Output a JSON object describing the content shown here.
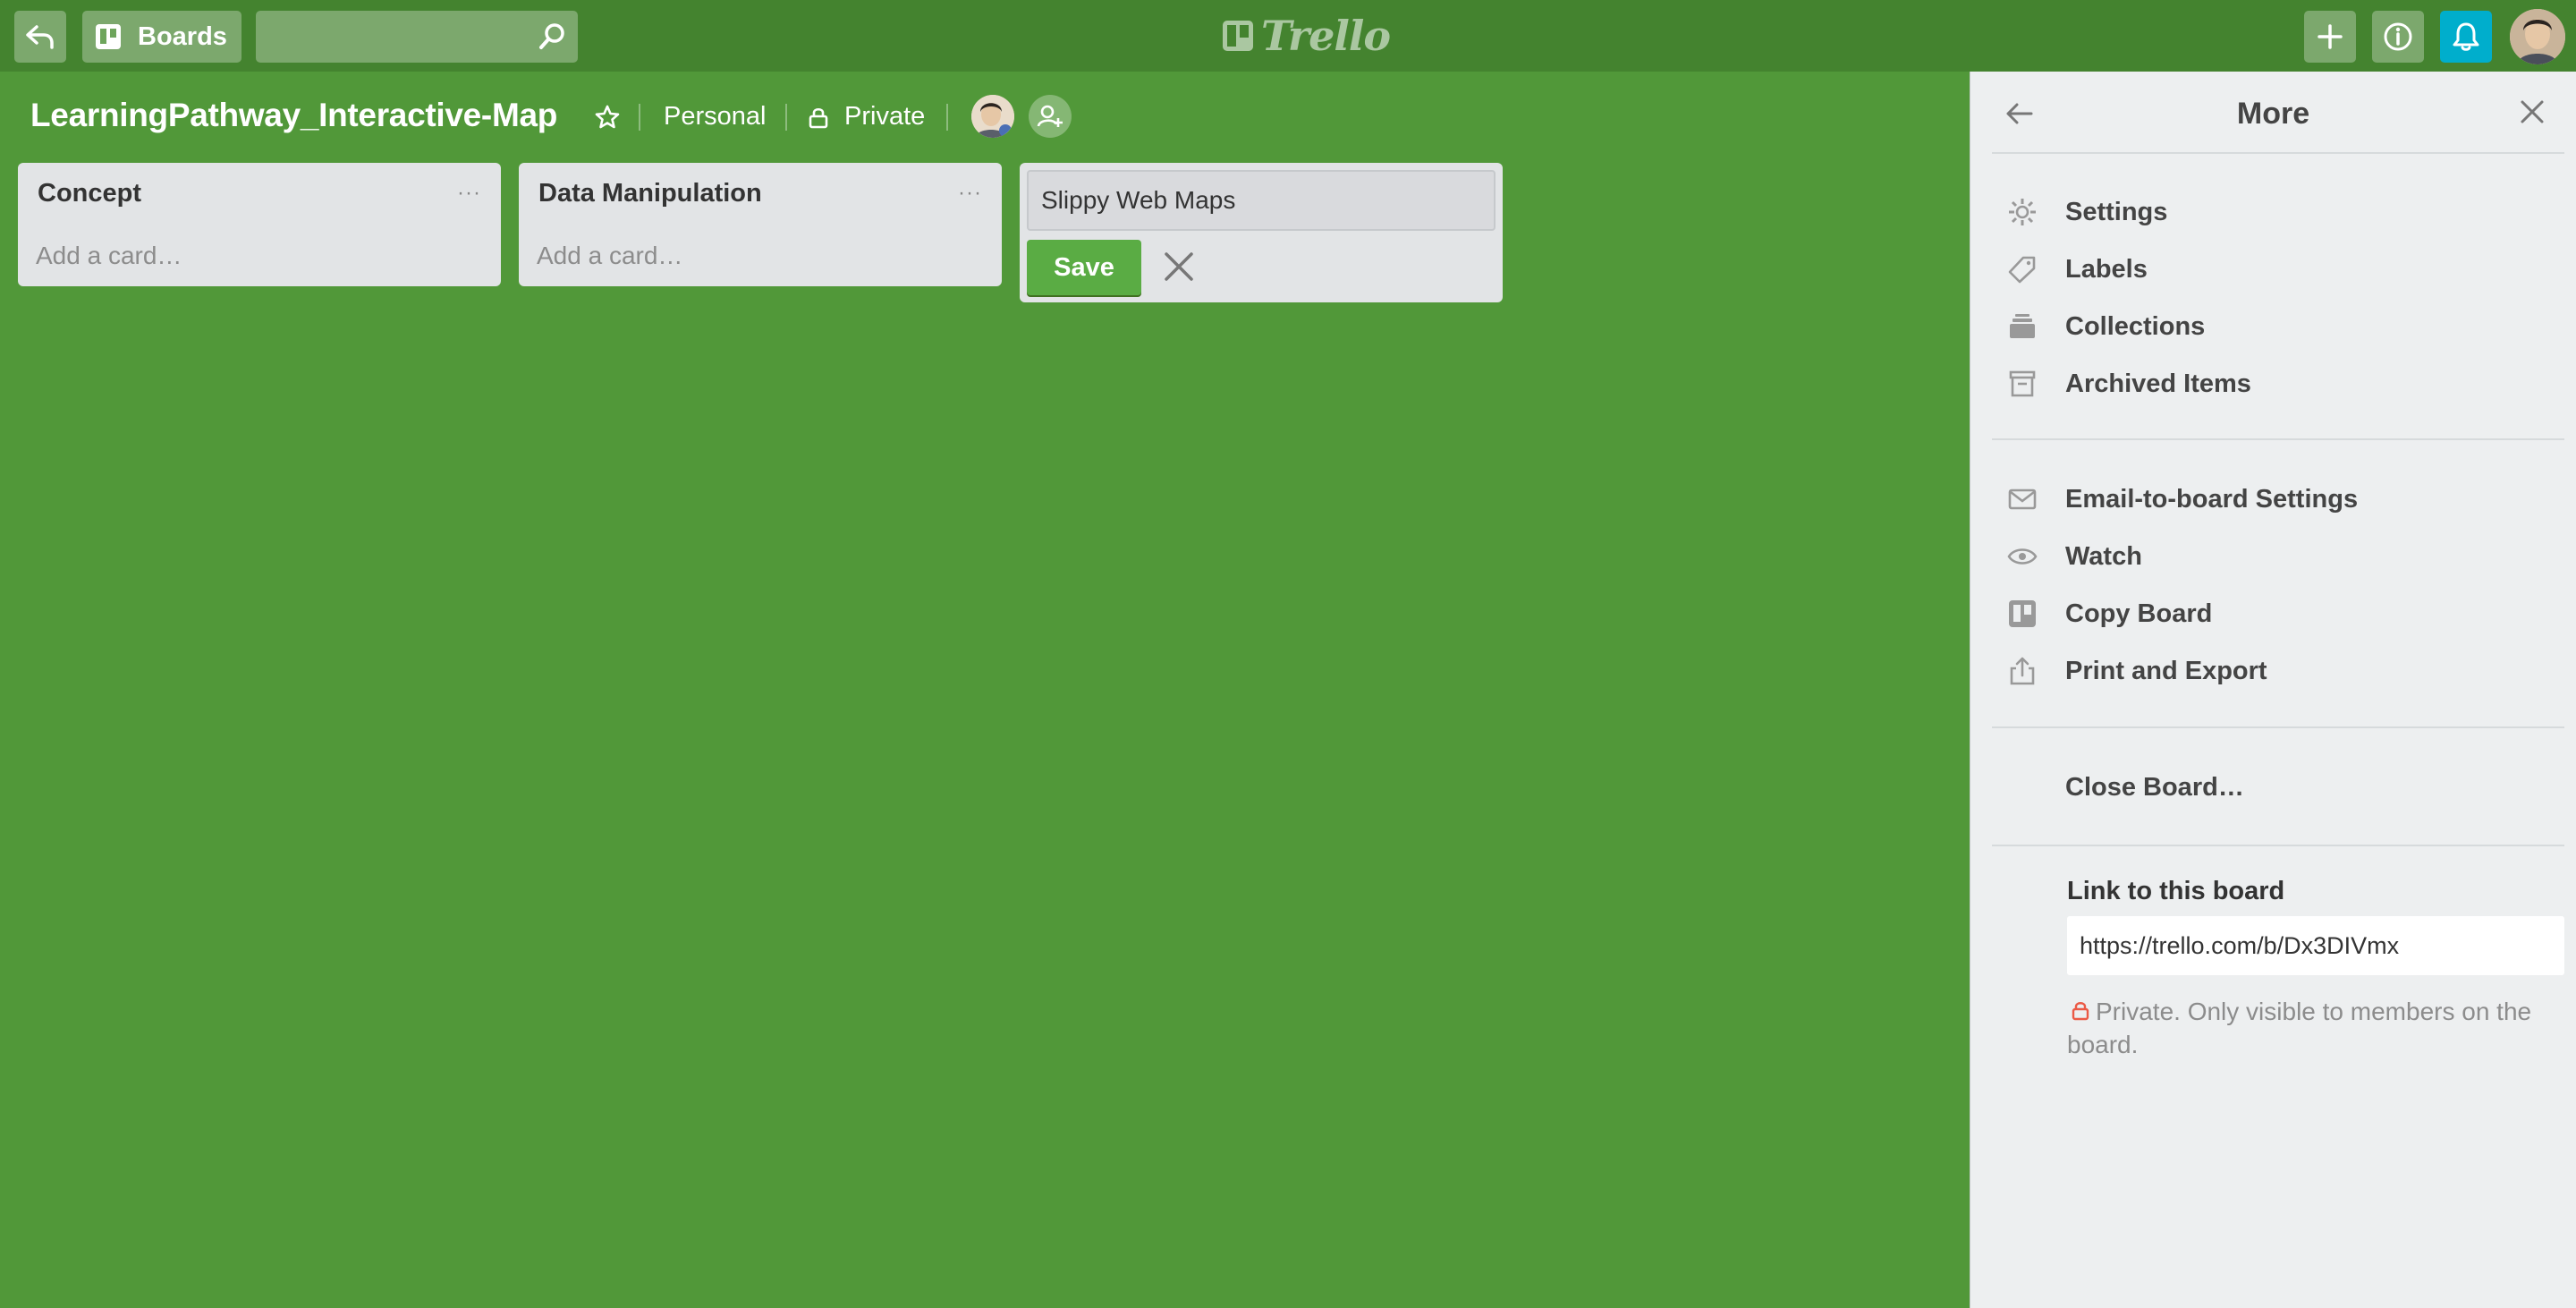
{
  "header": {
    "boards_label": "Boards",
    "search_placeholder": "",
    "logo_text": "Trello"
  },
  "board": {
    "title": "LearningPathway_Interactive-Map",
    "team": "Personal",
    "visibility": "Private"
  },
  "lists": [
    {
      "title": "Concept",
      "menu": "···",
      "add_card": "Add a card…"
    },
    {
      "title": "Data Manipulation",
      "menu": "···",
      "add_card": "Add a card…"
    }
  ],
  "new_list": {
    "value": "Slippy Web Maps",
    "save_label": "Save"
  },
  "panel": {
    "title": "More",
    "group1": [
      "Settings",
      "Labels",
      "Collections",
      "Archived Items"
    ],
    "group2": [
      "Email-to-board Settings",
      "Watch",
      "Copy Board",
      "Print and Export"
    ],
    "close_board": "Close Board…",
    "link_title": "Link to this board",
    "link_url": "https://trello.com/b/Dx3DIVmx",
    "privacy_note": "Private. Only visible to members on the board."
  },
  "colors": {
    "board_bg": "#519839",
    "header_bg": "#44832f",
    "notification": "#00aecc",
    "save_button": "#5aac44",
    "private_lock": "#eb5a46"
  },
  "icons": [
    "back-icon",
    "boards-icon",
    "search-icon",
    "trello-logo-icon",
    "plus-icon",
    "info-icon",
    "bell-icon",
    "star-icon",
    "lock-icon",
    "add-member-icon",
    "close-icon",
    "gear-icon",
    "label-icon",
    "collections-icon",
    "archive-icon",
    "mail-icon",
    "eye-icon",
    "copy-board-icon",
    "share-icon"
  ]
}
